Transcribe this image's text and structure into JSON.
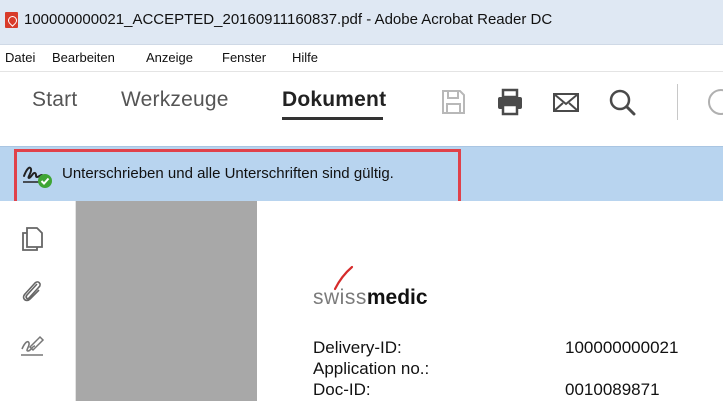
{
  "window": {
    "title": "100000000021_ACCEPTED_20160911160837.pdf - Adobe Acrobat Reader DC"
  },
  "menubar": {
    "items": [
      "Datei",
      "Bearbeiten",
      "Anzeige",
      "Fenster",
      "Hilfe"
    ]
  },
  "toolbar": {
    "tabs": [
      {
        "label": "Start",
        "active": false
      },
      {
        "label": "Werkzeuge",
        "active": false
      },
      {
        "label": "Dokument",
        "active": true
      }
    ],
    "icons": [
      "save-icon",
      "print-icon",
      "email-icon",
      "search-icon",
      "help-icon"
    ]
  },
  "signature_bar": {
    "message": "Unterschrieben und alle Unterschriften sind gültig.",
    "icon": "signature-valid-icon",
    "highlight_color": "#e0414a",
    "bar_color": "#b8d4ef"
  },
  "left_rail": {
    "icons": [
      "pages-icon",
      "attachment-icon",
      "signature-panel-icon"
    ]
  },
  "document": {
    "logo": {
      "part1": "swiss",
      "part2": "medic"
    },
    "fields": [
      {
        "label": "Delivery-ID:",
        "value": "100000000021"
      },
      {
        "label": "Application no.:",
        "value": ""
      },
      {
        "label": "Doc-ID:",
        "value": "0010089871"
      }
    ]
  }
}
